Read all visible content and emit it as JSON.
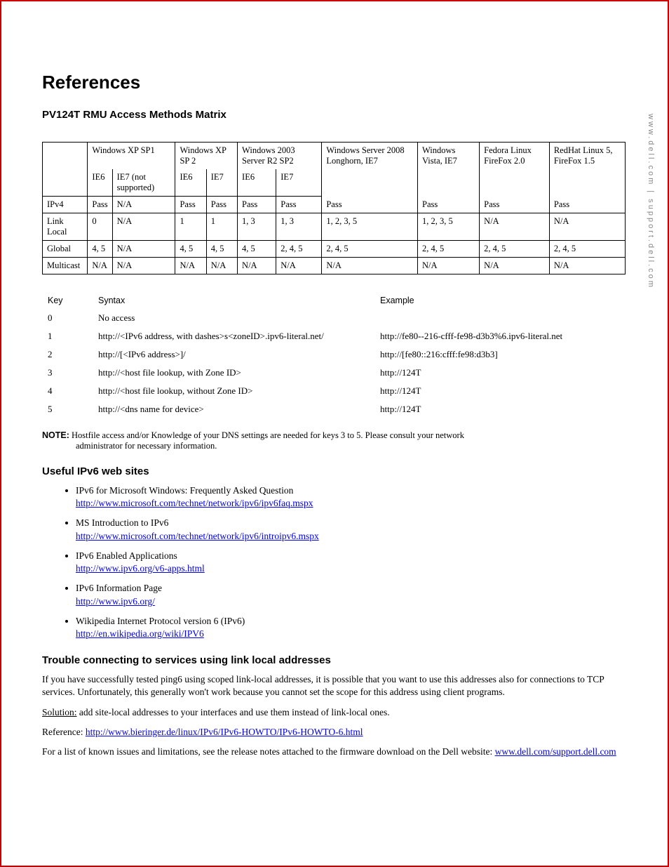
{
  "sidebar": "www.dell.com | support.dell.com",
  "h1": "References",
  "h2a": "PV124T RMU Access Methods Matrix",
  "matrix": {
    "colgroups": [
      {
        "top": "Windows XP SP1",
        "subs": [
          "IE6",
          "IE7 (not supported)"
        ]
      },
      {
        "top": "Windows XP SP 2",
        "subs": [
          "IE6",
          "IE7"
        ]
      },
      {
        "top": "Windows 2003 Server R2 SP2",
        "subs": [
          "IE6",
          "IE7"
        ]
      },
      {
        "top": "Windows Server 2008 Longhorn, IE7",
        "subs": []
      },
      {
        "top": "Windows Vista, IE7",
        "subs": []
      },
      {
        "top": "Fedora Linux FireFox 2.0",
        "subs": []
      },
      {
        "top": "RedHat Linux 5, FireFox 1.5",
        "subs": []
      }
    ],
    "rows": [
      {
        "label": "IPv4",
        "cells": [
          "Pass",
          "N/A",
          "Pass",
          "Pass",
          "Pass",
          "Pass",
          "Pass",
          "Pass",
          "Pass",
          "Pass"
        ]
      },
      {
        "label": "Link Local",
        "cells": [
          "0",
          "N/A",
          "1",
          "1",
          "1, 3",
          "1, 3",
          "1, 2, 3, 5",
          "1, 2, 3, 5",
          "N/A",
          "N/A"
        ]
      },
      {
        "label": "Global",
        "cells": [
          "4, 5",
          "N/A",
          "4, 5",
          "4, 5",
          "4, 5",
          "2, 4, 5",
          "2, 4, 5",
          "2, 4, 5",
          "2, 4, 5",
          "2, 4, 5"
        ]
      },
      {
        "label": "Multicast",
        "cells": [
          "N/A",
          "N/A",
          "N/A",
          "N/A",
          "N/A",
          "N/A",
          "N/A",
          "N/A",
          "N/A",
          "N/A"
        ]
      }
    ]
  },
  "key": {
    "headers": [
      "Key",
      "Syntax",
      "Example"
    ],
    "rows": [
      {
        "k": "0",
        "s": "No access",
        "e": ""
      },
      {
        "k": "1",
        "s": "http://<IPv6 address, with dashes>s<zoneID>.ipv6-literal.net/",
        "e": "http://fe80--216-cfff-fe98-d3b3%6.ipv6-literal.net"
      },
      {
        "k": "2",
        "s": "http://[<IPv6 address>]/",
        "e": "http://[fe80::216:cfff:fe98:d3b3]"
      },
      {
        "k": "3",
        "s": "http://<host file lookup, with Zone ID>",
        "e": "http://124T"
      },
      {
        "k": "4",
        "s": "http://<host file lookup, without Zone ID>",
        "e": "http://124T"
      },
      {
        "k": "5",
        "s": "http://<dns name for device>",
        "e": "http://124T"
      }
    ]
  },
  "note_label": "NOTE:",
  "note_text1": "Hostfile access and/or Knowledge of your DNS settings are needed for keys 3 to 5.   Please consult your network",
  "note_text2": "administrator for necessary information.",
  "h2b": "Useful IPv6 web sites",
  "links": [
    {
      "t": "IPv6 for Microsoft Windows: Frequently Asked Question",
      "u": "http://www.microsoft.com/technet/network/ipv6/ipv6faq.mspx"
    },
    {
      "t": "MS Introduction to IPv6",
      "u": "http://www.microsoft.com/technet/network/ipv6/introipv6.mspx"
    },
    {
      "t": "IPv6 Enabled Applications",
      "u": "http://www.ipv6.org/v6-apps.html"
    },
    {
      "t": "IPv6 Information Page",
      "u": "http://www.ipv6.org/"
    },
    {
      "t": "Wikipedia Internet Protocol version 6 (IPv6)",
      "u": "http://en.wikipedia.org/wiki/IPV6"
    }
  ],
  "h2c": "Trouble connecting to services using link local addresses",
  "p1": "If you have successfully tested ping6 using scoped link-local addresses, it is possible that you want to use this addresses also for connections to TCP services. Unfortunately, this generally won't work because you cannot set the scope for this address using client programs.",
  "solution_label": "Solution:",
  "solution_text": " add site-local addresses to your interfaces and use them instead of link-local ones.",
  "ref_label": "Reference: ",
  "ref_url": "http://www.bieringer.de/linux/IPv6/IPv6-HOWTO/IPv6-HOWTO-6.html",
  "p3a": "For a list of known issues and limitations, see the release notes attached to the firmware download on the Dell website: ",
  "p3b": "www.dell.com/support.dell.com "
}
